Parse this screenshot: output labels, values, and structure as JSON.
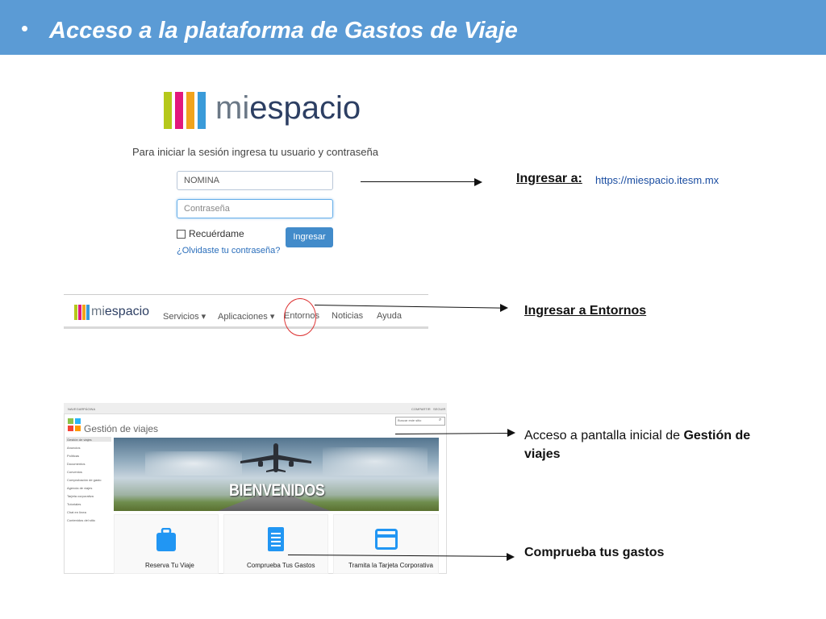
{
  "slide": {
    "bullet": "•",
    "title": "Acceso a la plataforma de Gastos de Viaje"
  },
  "login": {
    "logo_mi": "mi",
    "logo_espacio": "espacio",
    "instruction": "Para iniciar la sesión ingresa tu usuario y contraseña",
    "username_value": "NOMINA",
    "password_placeholder": "Contraseña",
    "remember_label": "Recuérdame",
    "submit_label": "Ingresar",
    "forgot_link": "¿Olvidaste tu contraseña?"
  },
  "nav": {
    "logo_mi": "mi",
    "logo_espacio": "espacio",
    "items": [
      "Servicios ▾",
      "Aplicaciones ▾",
      "Entornos",
      "Noticias",
      "Ayuda"
    ]
  },
  "gestion": {
    "top_left": [
      "NAVEGAR",
      "PÁGINA"
    ],
    "top_right": [
      "COMPARTIR",
      "SEGUIR"
    ],
    "title": "Gestión de viajes",
    "search_placeholder": "Buscar este sitio",
    "sidebar": [
      "Gestión de viajes",
      "Anuncios",
      "Políticas",
      "Documentos",
      "Convenios",
      "Comprobación de gasto",
      "Agencia de viajes",
      "Tarjeta corporativa",
      "Tutoriales",
      "Chat en línea",
      "Contenidos del sitio"
    ],
    "hero_text": "BIENVENIDOS",
    "tiles": [
      "Reserva Tu Viaje",
      "Comprueba Tus Gastos",
      "Tramita la Tarjeta Corporativa"
    ]
  },
  "annotations": {
    "ingresar_a": "Ingresar a:",
    "url": "https://miespacio.itesm.mx",
    "entornos": "Ingresar a Entornos",
    "gestion_prefix": "Acceso a pantalla inicial de ",
    "gestion_bold": "Gestión de viajes",
    "comprueba": "Comprueba tus gastos"
  },
  "colors": {
    "title_bar": "#5b9bd5",
    "logo_bars": [
      "#b5c81b",
      "#e2187d",
      "#f1a31c",
      "#3a9bd9"
    ],
    "button_blue": "#428bca",
    "tile_icon_blue": "#2196f3",
    "highlight_circle": "#dd3333"
  }
}
